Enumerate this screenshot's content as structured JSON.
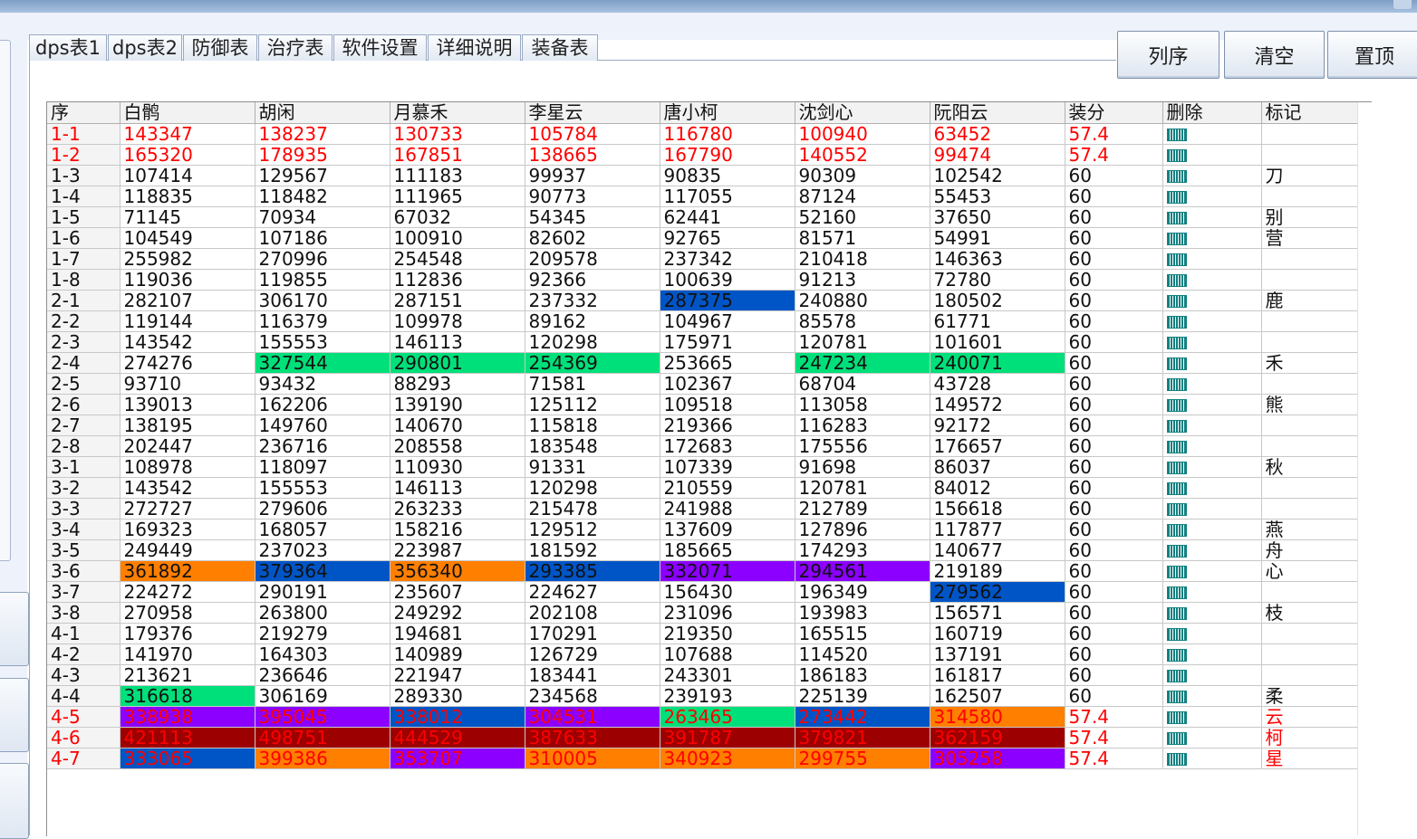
{
  "tabs": [
    {
      "label": "dps表1",
      "active": true
    },
    {
      "label": "dps表2"
    },
    {
      "label": "防御表"
    },
    {
      "label": "治疗表"
    },
    {
      "label": "软件设置"
    },
    {
      "label": "详细说明"
    },
    {
      "label": "装备表"
    }
  ],
  "buttons": {
    "sort": "列序",
    "clear": "清空",
    "top": "置顶"
  },
  "icon_delete": "delete-barcode-icon",
  "colors": {
    "red_text": "#ff0000",
    "green": "#00e07a",
    "blue": "#0055c6",
    "orange": "#ff7f00",
    "purple": "#8c00ff",
    "darkred": "#9c0000",
    "teal": "#128080"
  },
  "table": {
    "columns": [
      "序",
      "白鹘",
      "胡闲",
      "月慕禾",
      "李星云",
      "唐小柯",
      "沈剑心",
      "阮阳云",
      "装分",
      "删除",
      "标记"
    ],
    "rows": [
      {
        "id": "1-1",
        "values": [
          "143347",
          "138237",
          "130733",
          "105784",
          "116780",
          "100940",
          "63452"
        ],
        "score": "57.4",
        "mark": "",
        "red": true
      },
      {
        "id": "1-2",
        "values": [
          "165320",
          "178935",
          "167851",
          "138665",
          "167790",
          "140552",
          "99474"
        ],
        "score": "57.4",
        "mark": "",
        "red": true
      },
      {
        "id": "1-3",
        "values": [
          "107414",
          "129567",
          "111183",
          "99937",
          "90835",
          "90309",
          "102542"
        ],
        "score": "60",
        "mark": "刀"
      },
      {
        "id": "1-4",
        "values": [
          "118835",
          "118482",
          "111965",
          "90773",
          "117055",
          "87124",
          "55453"
        ],
        "score": "60",
        "mark": ""
      },
      {
        "id": "1-5",
        "values": [
          "71145",
          "70934",
          "67032",
          "54345",
          "62441",
          "52160",
          "37650"
        ],
        "score": "60",
        "mark": "别"
      },
      {
        "id": "1-6",
        "values": [
          "104549",
          "107186",
          "100910",
          "82602",
          "92765",
          "81571",
          "54991"
        ],
        "score": "60",
        "mark": "营"
      },
      {
        "id": "1-7",
        "values": [
          "255982",
          "270996",
          "254548",
          "209578",
          "237342",
          "210418",
          "146363"
        ],
        "score": "60",
        "mark": ""
      },
      {
        "id": "1-8",
        "values": [
          "119036",
          "119855",
          "112836",
          "92366",
          "100639",
          "91213",
          "72780"
        ],
        "score": "60",
        "mark": ""
      },
      {
        "id": "2-1",
        "values": [
          "282107",
          "306170",
          "287151",
          "237332",
          "287375",
          "240880",
          "180502"
        ],
        "score": "60",
        "mark": "鹿",
        "hl": {
          "4": "blue"
        }
      },
      {
        "id": "2-2",
        "values": [
          "119144",
          "116379",
          "109978",
          "89162",
          "104967",
          "85578",
          "61771"
        ],
        "score": "60",
        "mark": ""
      },
      {
        "id": "2-3",
        "values": [
          "143542",
          "155553",
          "146113",
          "120298",
          "175971",
          "120781",
          "101601"
        ],
        "score": "60",
        "mark": ""
      },
      {
        "id": "2-4",
        "values": [
          "274276",
          "327544",
          "290801",
          "254369",
          "253665",
          "247234",
          "240071"
        ],
        "score": "60",
        "mark": "禾",
        "hl": {
          "1": "green",
          "2": "green",
          "3": "green",
          "5": "green",
          "6": "green"
        }
      },
      {
        "id": "2-5",
        "values": [
          "93710",
          "93432",
          "88293",
          "71581",
          "102367",
          "68704",
          "43728"
        ],
        "score": "60",
        "mark": ""
      },
      {
        "id": "2-6",
        "values": [
          "139013",
          "162206",
          "139190",
          "125112",
          "109518",
          "113058",
          "149572"
        ],
        "score": "60",
        "mark": "熊"
      },
      {
        "id": "2-7",
        "values": [
          "138195",
          "149760",
          "140670",
          "115818",
          "219366",
          "116283",
          "92172"
        ],
        "score": "60",
        "mark": ""
      },
      {
        "id": "2-8",
        "values": [
          "202447",
          "236716",
          "208558",
          "183548",
          "172683",
          "175556",
          "176657"
        ],
        "score": "60",
        "mark": ""
      },
      {
        "id": "3-1",
        "values": [
          "108978",
          "118097",
          "110930",
          "91331",
          "107339",
          "91698",
          "86037"
        ],
        "score": "60",
        "mark": "秋"
      },
      {
        "id": "3-2",
        "values": [
          "143542",
          "155553",
          "146113",
          "120298",
          "210559",
          "120781",
          "84012"
        ],
        "score": "60",
        "mark": ""
      },
      {
        "id": "3-3",
        "values": [
          "272727",
          "279606",
          "263233",
          "215478",
          "241988",
          "212789",
          "156618"
        ],
        "score": "60",
        "mark": ""
      },
      {
        "id": "3-4",
        "values": [
          "169323",
          "168057",
          "158216",
          "129512",
          "137609",
          "127896",
          "117877"
        ],
        "score": "60",
        "mark": "燕"
      },
      {
        "id": "3-5",
        "values": [
          "249449",
          "237023",
          "223987",
          "181592",
          "185665",
          "174293",
          "140677"
        ],
        "score": "60",
        "mark": "舟"
      },
      {
        "id": "3-6",
        "values": [
          "361892",
          "379364",
          "356340",
          "293385",
          "332071",
          "294561",
          "219189"
        ],
        "score": "60",
        "mark": "心",
        "hl": {
          "0": "orange",
          "1": "blue",
          "2": "orange",
          "3": "blue",
          "4": "purple",
          "5": "purple"
        }
      },
      {
        "id": "3-7",
        "values": [
          "224272",
          "290191",
          "235607",
          "224627",
          "156430",
          "196349",
          "279562"
        ],
        "score": "60",
        "mark": "",
        "hl": {
          "6": "blue"
        }
      },
      {
        "id": "3-8",
        "values": [
          "270958",
          "263800",
          "249292",
          "202108",
          "231096",
          "193983",
          "156571"
        ],
        "score": "60",
        "mark": "枝"
      },
      {
        "id": "4-1",
        "values": [
          "179376",
          "219279",
          "194681",
          "170291",
          "219350",
          "165515",
          "160719"
        ],
        "score": "60",
        "mark": ""
      },
      {
        "id": "4-2",
        "values": [
          "141970",
          "164303",
          "140989",
          "126729",
          "107688",
          "114520",
          "137191"
        ],
        "score": "60",
        "mark": ""
      },
      {
        "id": "4-3",
        "values": [
          "213621",
          "236646",
          "221947",
          "183441",
          "243301",
          "186183",
          "161817"
        ],
        "score": "60",
        "mark": ""
      },
      {
        "id": "4-4",
        "values": [
          "316618",
          "306169",
          "289330",
          "234568",
          "239193",
          "225139",
          "162507"
        ],
        "score": "60",
        "mark": "柔",
        "hl": {
          "0": "green"
        }
      },
      {
        "id": "4-5",
        "values": [
          "338938",
          "395045",
          "338012",
          "304531",
          "263465",
          "273442",
          "314580"
        ],
        "score": "57.4",
        "mark": "云",
        "red": true,
        "hl": {
          "0": "purple",
          "1": "purple",
          "2": "blue",
          "3": "purple",
          "4": "green",
          "5": "blue",
          "6": "orange"
        }
      },
      {
        "id": "4-6",
        "values": [
          "421113",
          "498751",
          "444529",
          "387633",
          "391787",
          "379821",
          "362159"
        ],
        "score": "57.4",
        "mark": "柯",
        "red": true,
        "hl": {
          "0": "darkred",
          "1": "darkred",
          "2": "darkred",
          "3": "darkred",
          "4": "darkred",
          "5": "darkred",
          "6": "darkred"
        }
      },
      {
        "id": "4-7",
        "values": [
          "333065",
          "399386",
          "353707",
          "310005",
          "340923",
          "299755",
          "305258"
        ],
        "score": "57.4",
        "mark": "星",
        "red": true,
        "hl": {
          "0": "blue",
          "1": "orange",
          "2": "purple",
          "3": "orange",
          "4": "orange",
          "5": "orange",
          "6": "purple"
        }
      }
    ]
  }
}
